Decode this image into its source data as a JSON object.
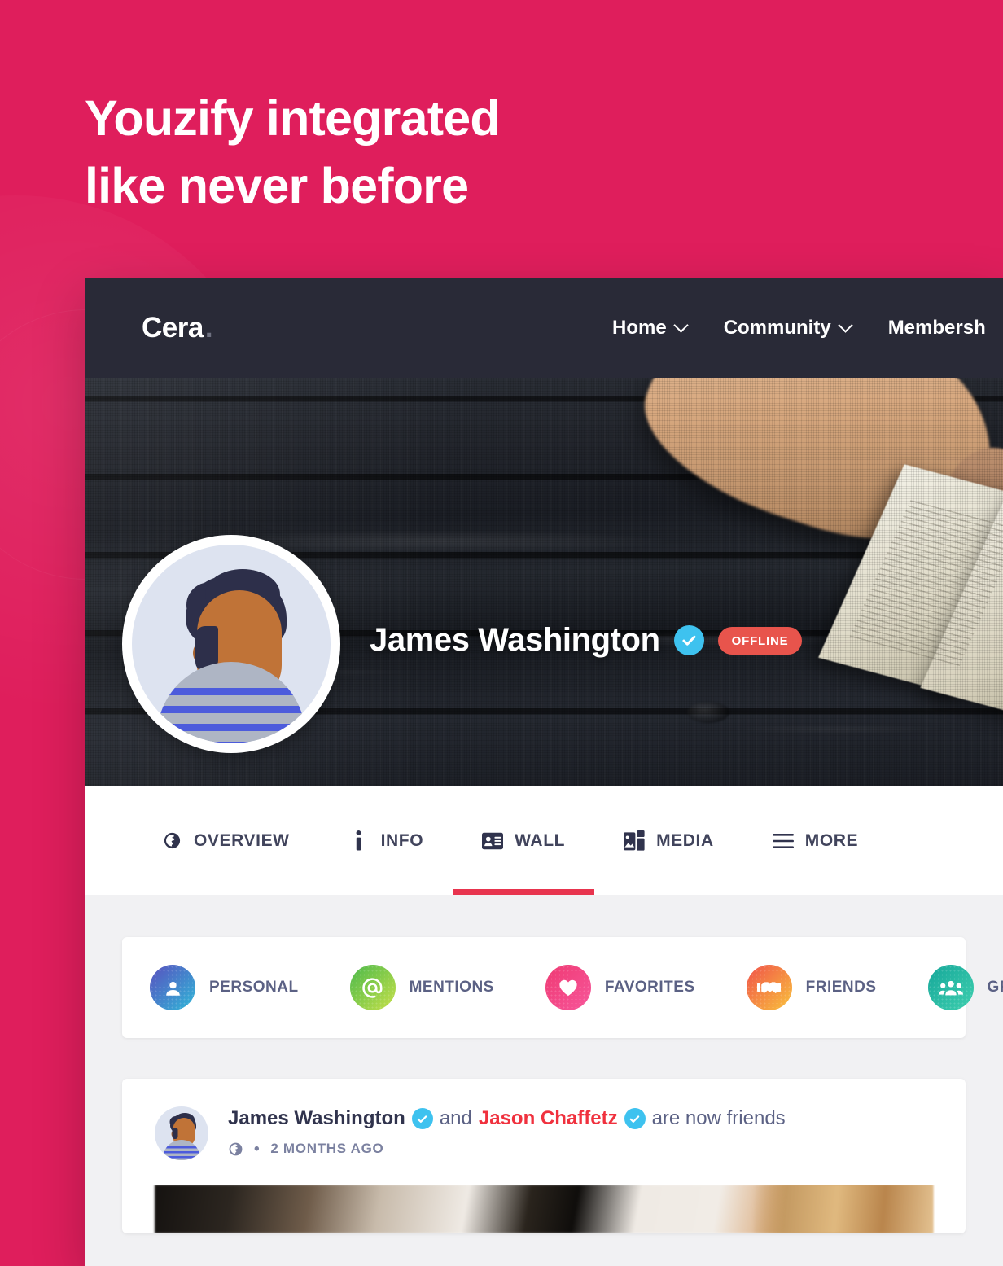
{
  "promo": {
    "headline": "Youzify integrated\nlike never before",
    "background_color": "#df1e5c"
  },
  "navbar": {
    "brand": "Cera",
    "brand_dot": ".",
    "background_color": "#292a37",
    "items": [
      {
        "label": "Home",
        "has_caret": true
      },
      {
        "label": "Community",
        "has_caret": true
      },
      {
        "label": "Membersh",
        "has_caret": false
      }
    ]
  },
  "profile": {
    "name": "James Washington",
    "verified": true,
    "status_badge": "OFFLINE",
    "status_color": "#e8544c",
    "avatar_icon": "user-avatar-illustration",
    "cover_icon": "cover-photo-book-on-wood"
  },
  "tabs": [
    {
      "label": "OVERVIEW",
      "icon": "globe-icon",
      "active": false
    },
    {
      "label": "INFO",
      "icon": "info-icon",
      "active": false
    },
    {
      "label": "WALL",
      "icon": "id-card-icon",
      "active": true
    },
    {
      "label": "MEDIA",
      "icon": "images-icon",
      "active": false
    },
    {
      "label": "MORE",
      "icon": "hamburger-icon",
      "active": false
    }
  ],
  "tab_active_color": "#e8344e",
  "filters": [
    {
      "label": "PERSONAL",
      "icon": "person-circle-icon",
      "color_from": "#5a4fbf",
      "color_to": "#2fb8d8"
    },
    {
      "label": "MENTIONS",
      "icon": "at-sign-icon",
      "color_from": "#4bb94b",
      "color_to": "#c6e04a"
    },
    {
      "label": "FAVORITES",
      "icon": "heart-icon",
      "color_from": "#ef3a73",
      "color_to": "#f7569a"
    },
    {
      "label": "FRIENDS",
      "icon": "handshake-icon",
      "color_from": "#f0514a",
      "color_to": "#f9c23c"
    },
    {
      "label": "GROUPS",
      "icon": "people-group-icon",
      "color_from": "#16a79a",
      "color_to": "#3ecfae"
    }
  ],
  "activity": {
    "actor": "James Washington",
    "actor_verified": true,
    "connector": "and",
    "target": "Jason Chaffetz",
    "target_verified": true,
    "suffix": "are now friends",
    "privacy_icon": "globe-icon",
    "separator": "•",
    "timestamp": "2 MONTHS AGO",
    "attachment_icon": "photo-attachment"
  }
}
